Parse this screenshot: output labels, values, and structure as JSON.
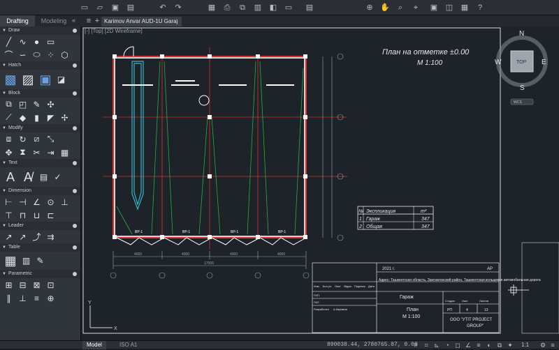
{
  "workspace_tabs": {
    "drafting": "Drafting",
    "modeling": "Modeling"
  },
  "document_tab": "Karimov Anvar AUD-1U Garaj",
  "view_label": "[-] [Top] [2D Wireframe]",
  "palette": {
    "sections": [
      "Draw",
      "Hatch",
      "Block",
      "Modify",
      "Text",
      "Dimension",
      "Leader",
      "Table",
      "Parametric"
    ]
  },
  "drawing": {
    "title_line1": "План на отметке ±0.00",
    "title_line2": "М 1:100",
    "explication": {
      "header_no": "№",
      "header_name": "Экспликация",
      "header_unit": "m²",
      "rows": [
        {
          "no": "1",
          "name": "Гараж",
          "area": "347"
        },
        {
          "no": "2",
          "name": "Общая",
          "area": "347"
        }
      ]
    },
    "stamp": {
      "year": "2021 г.",
      "code": "AP",
      "address": "Адрес: Ташкентская область, Зангиатинский район, Ташкентская кольцевая автомобильная дорога",
      "object": "Гараж",
      "sheet_title_1": "План",
      "sheet_title_2": "М 1:100",
      "stage_h": "Стадия",
      "sheet_h": "Лист",
      "sheets_h": "Листов",
      "stage": "РП",
      "sheet": "4",
      "sheets": "13",
      "company_1": "ООО \"УТІТ PROJECT",
      "company_2": "GROUP\"",
      "col_izm": "Изм.",
      "col_kol": "Кол.уч.",
      "col_list": "Лист",
      "col_doc": "№док.",
      "col_sign": "Подпись",
      "col_date": "Дата",
      "gip": "ГИП",
      "gap": "ГАП",
      "razrab": "Разработал",
      "person": "А.Каримов"
    },
    "dims": {
      "d1": "4000",
      "d2": "4000",
      "d3": "4000",
      "d4": "4000",
      "total": "17000"
    },
    "labels": {
      "vr": "ВР-1"
    }
  },
  "viewcube": {
    "n": "N",
    "s": "S",
    "e": "E",
    "w": "W",
    "top": "TOP",
    "wcs": "WCS"
  },
  "axis": {
    "x": "X",
    "y": "Y"
  },
  "status": {
    "model_tab": "Model",
    "layout_tab": "ISO A1",
    "coords": "890038.44, 2780765.87, 0.00",
    "scale": "1:1"
  },
  "colors": {
    "accent_red": "#d8312f",
    "bg": "#1e2329",
    "green": "#2ea84a",
    "cyan": "#3ab6c8"
  }
}
